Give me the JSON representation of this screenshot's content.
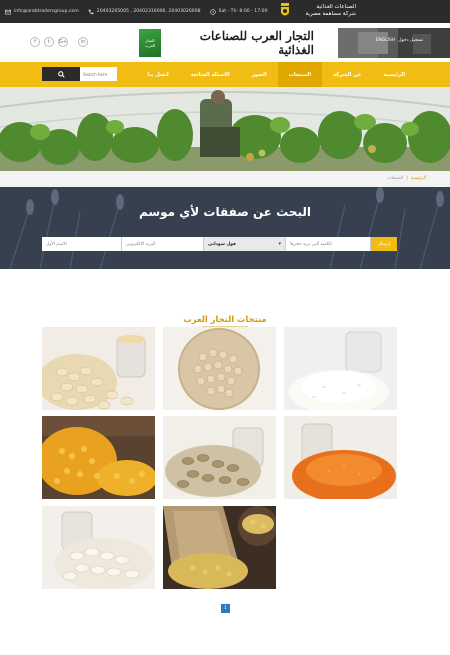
{
  "topbar": {
    "email": "info@arabtradersgroup.com",
    "phones": "20403265005 , 20402316006, 20403026008",
    "hours": "Sat - Th: 8:00 - 17:00",
    "sister_company_line1": "الصناعات الغذائية",
    "sister_company_line2": "شركة مساهمة مصرية"
  },
  "header": {
    "logo_text_line1": "التجار",
    "logo_text_line2": "العرب",
    "company_name": "التجار العرب للصناعات الغذائية",
    "lang_english": "ENGLISH",
    "lang_login": "تسجيل دخول",
    "social": [
      "f",
      "t",
      "G+",
      "in"
    ]
  },
  "nav": {
    "items": [
      {
        "label": "الرئيسية",
        "active": false
      },
      {
        "label": "عن الشركة",
        "active": false
      },
      {
        "label": "المنتجات",
        "active": true
      },
      {
        "label": "الصور",
        "active": false
      },
      {
        "label": "الاسئلة الشائعة",
        "active": false
      },
      {
        "label": "اتصل بنا",
        "active": false
      }
    ],
    "search_placeholder": "Search here"
  },
  "breadcrumb": {
    "home": "الرئيسية",
    "separator": "|",
    "current": "المنتجات"
  },
  "deal": {
    "title": "البحث عن صفقات لأي موسم",
    "send_label": "إرسال",
    "quantity_placeholder": "الكمية التي تريد حجزها",
    "product_selected": "فول سوداني",
    "email_placeholder": "البريد الالكتروني",
    "name_placeholder": "الاسم الأول"
  },
  "products": {
    "title": "منتجات التجار العرب",
    "pagination_current": "1"
  },
  "colors": {
    "accent": "#f2bd13",
    "topbar": "#2b2b2b",
    "deal_bg": "#34404f",
    "pager": "#2f79c4"
  }
}
